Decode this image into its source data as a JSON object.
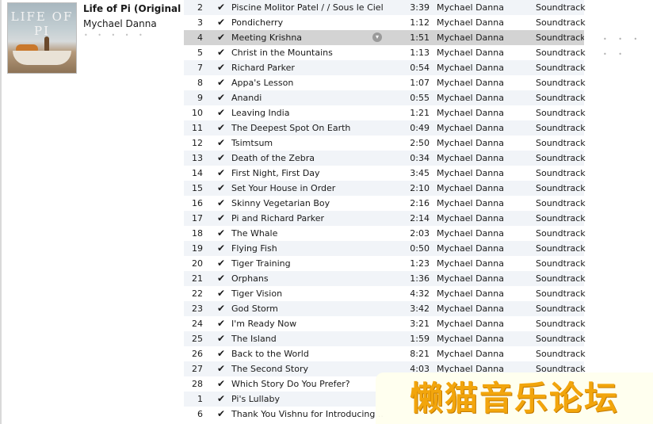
{
  "album": {
    "art_text": "LIFE OF PI",
    "title": "Life of Pi (Original M...",
    "artist": "Mychael Danna",
    "rating_dots": "• • • • •"
  },
  "tracks": [
    {
      "num": "2",
      "name": "Piscine Molitor Patel / / Sous le Ciel...",
      "time": "3:39",
      "artist": "Mychael Danna",
      "genre": "Soundtrack"
    },
    {
      "num": "3",
      "name": "Pondicherry",
      "time": "1:12",
      "artist": "Mychael Danna",
      "genre": "Soundtrack"
    },
    {
      "num": "4",
      "name": "Meeting Krishna",
      "time": "1:51",
      "artist": "Mychael Danna",
      "genre": "Soundtrack",
      "selected": true
    },
    {
      "num": "5",
      "name": "Christ in the Mountains",
      "time": "1:13",
      "artist": "Mychael Danna",
      "genre": "Soundtrack"
    },
    {
      "num": "7",
      "name": "Richard Parker",
      "time": "0:54",
      "artist": "Mychael Danna",
      "genre": "Soundtrack"
    },
    {
      "num": "8",
      "name": "Appa's Lesson",
      "time": "1:07",
      "artist": "Mychael Danna",
      "genre": "Soundtrack"
    },
    {
      "num": "9",
      "name": "Anandi",
      "time": "0:55",
      "artist": "Mychael Danna",
      "genre": "Soundtrack"
    },
    {
      "num": "10",
      "name": "Leaving India",
      "time": "1:21",
      "artist": "Mychael Danna",
      "genre": "Soundtrack"
    },
    {
      "num": "11",
      "name": "The Deepest Spot On Earth",
      "time": "0:49",
      "artist": "Mychael Danna",
      "genre": "Soundtrack"
    },
    {
      "num": "12",
      "name": "Tsimtsum",
      "time": "2:50",
      "artist": "Mychael Danna",
      "genre": "Soundtrack"
    },
    {
      "num": "13",
      "name": "Death of the Zebra",
      "time": "0:34",
      "artist": "Mychael Danna",
      "genre": "Soundtrack"
    },
    {
      "num": "14",
      "name": "First Night, First Day",
      "time": "3:45",
      "artist": "Mychael Danna",
      "genre": "Soundtrack"
    },
    {
      "num": "15",
      "name": "Set Your House in Order",
      "time": "2:10",
      "artist": "Mychael Danna",
      "genre": "Soundtrack"
    },
    {
      "num": "16",
      "name": "Skinny Vegetarian Boy",
      "time": "2:16",
      "artist": "Mychael Danna",
      "genre": "Soundtrack"
    },
    {
      "num": "17",
      "name": "Pi and Richard Parker",
      "time": "2:14",
      "artist": "Mychael Danna",
      "genre": "Soundtrack"
    },
    {
      "num": "18",
      "name": "The Whale",
      "time": "2:03",
      "artist": "Mychael Danna",
      "genre": "Soundtrack"
    },
    {
      "num": "19",
      "name": "Flying Fish",
      "time": "0:50",
      "artist": "Mychael Danna",
      "genre": "Soundtrack"
    },
    {
      "num": "20",
      "name": "Tiger Training",
      "time": "1:23",
      "artist": "Mychael Danna",
      "genre": "Soundtrack"
    },
    {
      "num": "21",
      "name": "Orphans",
      "time": "1:36",
      "artist": "Mychael Danna",
      "genre": "Soundtrack"
    },
    {
      "num": "22",
      "name": "Tiger Vision",
      "time": "4:32",
      "artist": "Mychael Danna",
      "genre": "Soundtrack"
    },
    {
      "num": "23",
      "name": "God Storm",
      "time": "3:42",
      "artist": "Mychael Danna",
      "genre": "Soundtrack"
    },
    {
      "num": "24",
      "name": "I'm Ready Now",
      "time": "3:21",
      "artist": "Mychael Danna",
      "genre": "Soundtrack"
    },
    {
      "num": "25",
      "name": "The Island",
      "time": "1:59",
      "artist": "Mychael Danna",
      "genre": "Soundtrack"
    },
    {
      "num": "26",
      "name": "Back to the World",
      "time": "8:21",
      "artist": "Mychael Danna",
      "genre": "Soundtrack"
    },
    {
      "num": "27",
      "name": "The Second Story",
      "time": "4:03",
      "artist": "Mychael Danna",
      "genre": "Soundtrack"
    },
    {
      "num": "28",
      "name": "Which Story Do You Prefer?",
      "time": "",
      "artist": "",
      "genre": ""
    },
    {
      "num": "1",
      "name": "Pi's Lullaby",
      "time": "",
      "artist": "",
      "genre": ""
    },
    {
      "num": "6",
      "name": "Thank You Vishnu for Introducing ...",
      "time": "",
      "artist": "",
      "genre": ""
    }
  ],
  "checkmark": "✔",
  "row_action_glyph": "▾",
  "selected_row_rating_dots": "• • • • •",
  "watermark": "懒猫音乐论坛",
  "colors": {
    "row_alt": "#f1f4f8",
    "row_selected": "#d3d3d3",
    "watermark": "#f2a50c"
  }
}
